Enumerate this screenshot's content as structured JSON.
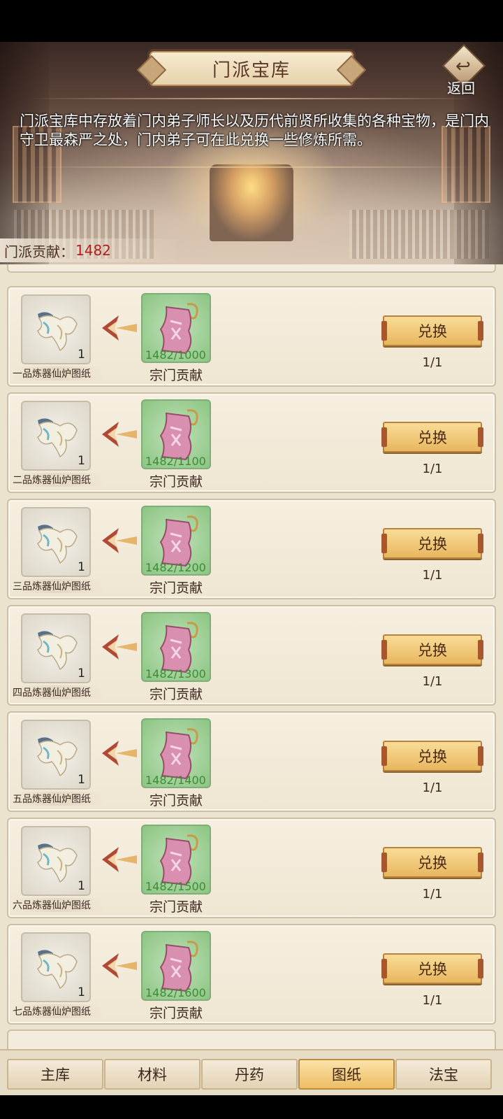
{
  "header": {
    "title": "门派宝库",
    "back_label": "返回",
    "description": "门派宝库中存放着门内弟子师长以及历代前贤所收集的各种宝物，是门内守卫最森严之处，门内弟子可在此兑换一些修炼所需。",
    "contribution_label": "门派贡献：",
    "contribution_value": "1482"
  },
  "items": [
    {
      "name": "一品炼器仙炉图纸",
      "count": "1",
      "cost_progress": "1482/1000",
      "cost_name": "宗门贡献",
      "button": "兑换",
      "limit": "1/1"
    },
    {
      "name": "二品炼器仙炉图纸",
      "count": "1",
      "cost_progress": "1482/1100",
      "cost_name": "宗门贡献",
      "button": "兑换",
      "limit": "1/1"
    },
    {
      "name": "三品炼器仙炉图纸",
      "count": "1",
      "cost_progress": "1482/1200",
      "cost_name": "宗门贡献",
      "button": "兑换",
      "limit": "1/1"
    },
    {
      "name": "四品炼器仙炉图纸",
      "count": "1",
      "cost_progress": "1482/1300",
      "cost_name": "宗门贡献",
      "button": "兑换",
      "limit": "1/1"
    },
    {
      "name": "五品炼器仙炉图纸",
      "count": "1",
      "cost_progress": "1482/1400",
      "cost_name": "宗门贡献",
      "button": "兑换",
      "limit": "1/1"
    },
    {
      "name": "六品炼器仙炉图纸",
      "count": "1",
      "cost_progress": "1482/1500",
      "cost_name": "宗门贡献",
      "button": "兑换",
      "limit": "1/1"
    },
    {
      "name": "七品炼器仙炉图纸",
      "count": "1",
      "cost_progress": "1482/1600",
      "cost_name": "宗门贡献",
      "button": "兑换",
      "limit": "1/1"
    }
  ],
  "tabs": [
    {
      "label": "主库",
      "active": false
    },
    {
      "label": "材料",
      "active": false
    },
    {
      "label": "丹药",
      "active": false
    },
    {
      "label": "图纸",
      "active": true
    },
    {
      "label": "法宝",
      "active": false
    }
  ],
  "icons": {
    "item": "blueprint-scroll-icon",
    "cost": "sect-token-icon",
    "arrow": "exchange-arrow-icon",
    "back": "back-arrow-icon"
  },
  "colors": {
    "accent_gold": "#eebd63",
    "contribution_value": "#b02020",
    "cost_progress": "#3d8a3a"
  }
}
